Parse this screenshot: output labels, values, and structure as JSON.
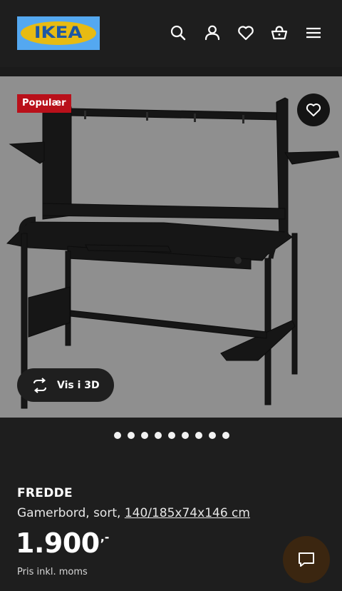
{
  "header": {
    "logo_text": "IKEA",
    "icons": [
      "search-icon",
      "user-icon",
      "heart-icon",
      "basket-icon",
      "menu-icon"
    ]
  },
  "hero": {
    "badge": "Populær",
    "vis3d_label": "Vis i 3D",
    "slide_count": 9,
    "background_color": "#8f8f8f"
  },
  "product": {
    "name": "FREDDE",
    "description": "Gamerbord, sort,",
    "dimensions": "140/185x74x146 cm",
    "price": "1.900",
    "price_suffix": ",-",
    "vat_note": "Pris inkl. moms"
  },
  "colors": {
    "background": "#1e1e1e",
    "badge": "#b9101a",
    "chat_button": "#3b2610"
  }
}
